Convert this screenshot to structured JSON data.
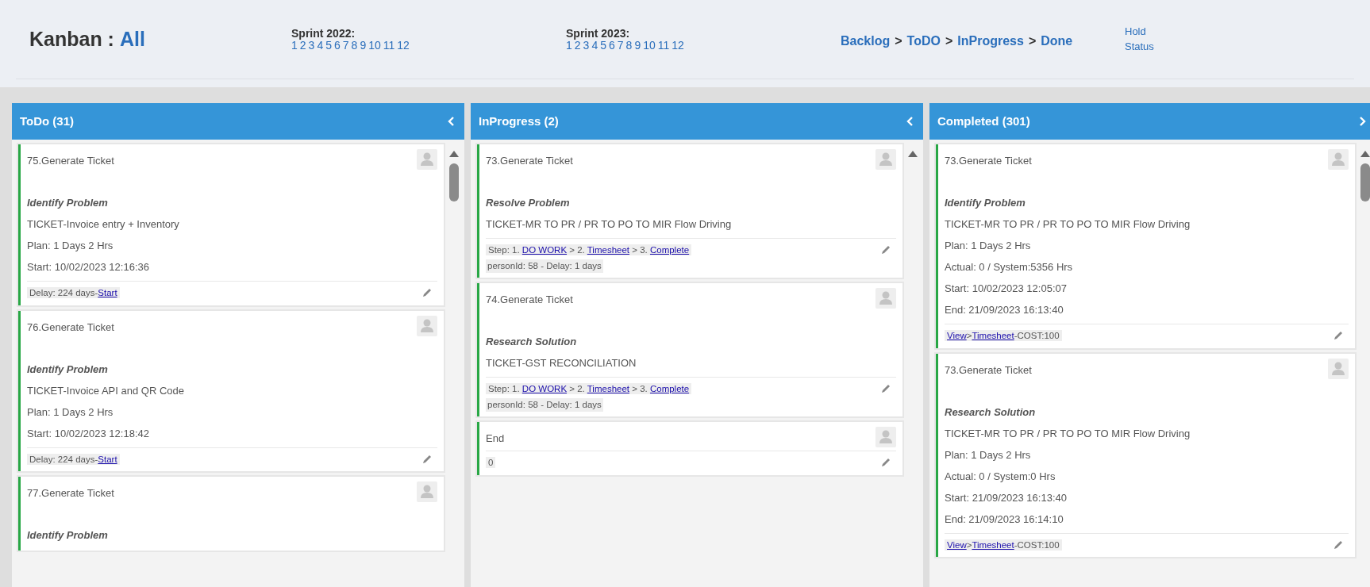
{
  "header": {
    "title": "Kanban :",
    "filter": "All",
    "sprints": [
      {
        "label": "Sprint 2022:",
        "numbers": [
          "1",
          "2",
          "3",
          "4",
          "5",
          "6",
          "7",
          "8",
          "9",
          "10",
          "11",
          "12"
        ]
      },
      {
        "label": "Sprint 2023:",
        "numbers": [
          "1",
          "2",
          "3",
          "4",
          "5",
          "6",
          "7",
          "8",
          "9",
          "10",
          "11",
          "12"
        ]
      }
    ],
    "workflow": [
      {
        "text": "Backlog",
        "kind": "link"
      },
      {
        "text": ">",
        "kind": "separator"
      },
      {
        "text": "ToDO",
        "kind": "link"
      },
      {
        "text": ">",
        "kind": "separator"
      },
      {
        "text": "InProgress",
        "kind": "link"
      },
      {
        "text": ">",
        "kind": "separator"
      },
      {
        "text": "Done",
        "kind": "link"
      }
    ],
    "extra_links": [
      "Hold",
      "Status"
    ]
  },
  "columns": [
    {
      "title": "ToDo (31)",
      "chevron_right": false,
      "scrollable": true,
      "cards": [
        {
          "title": "75.Generate Ticket",
          "stage": "Identify Problem",
          "lines": [
            "TICKET-Invoice entry + Inventory",
            "Plan: 1 Days 2 Hrs",
            "Start: 10/02/2023 12:16:36"
          ],
          "footer": [
            {
              "text": "Delay: 224 days-",
              "kind": "text"
            },
            {
              "text": "Start",
              "kind": "link"
            }
          ]
        },
        {
          "title": "76.Generate Ticket",
          "stage": "Identify Problem",
          "lines": [
            "TICKET-Invoice API and QR Code",
            "Plan: 1 Days 2 Hrs",
            "Start: 10/02/2023 12:18:42"
          ],
          "footer": [
            {
              "text": "Delay: 224 days-",
              "kind": "text"
            },
            {
              "text": "Start",
              "kind": "link"
            }
          ]
        },
        {
          "title": "77.Generate Ticket",
          "stage": "Identify Problem"
        }
      ]
    },
    {
      "title": "InProgress (2)",
      "chevron_right": false,
      "scrollable": false,
      "cards": [
        {
          "title": "73.Generate Ticket",
          "stage": "Resolve Problem",
          "lines": [
            "TICKET-MR TO PR / PR TO PO TO MIR Flow Driving"
          ],
          "footer": [
            {
              "text": "Step: 1. ",
              "kind": "text"
            },
            {
              "text": "DO WORK",
              "kind": "link"
            },
            {
              "text": " > 2. ",
              "kind": "text"
            },
            {
              "text": "Timesheet",
              "kind": "link"
            },
            {
              "text": " > 3. ",
              "kind": "text"
            },
            {
              "text": "Complete",
              "kind": "link"
            }
          ],
          "note": "personId: 58 - Delay: 1 days"
        },
        {
          "title": "74.Generate Ticket",
          "stage": "Research Solution",
          "lines": [
            "TICKET-GST RECONCILIATION"
          ],
          "footer": [
            {
              "text": "Step: 1. ",
              "kind": "text"
            },
            {
              "text": "DO WORK",
              "kind": "link"
            },
            {
              "text": " > 2. ",
              "kind": "text"
            },
            {
              "text": "Timesheet",
              "kind": "link"
            },
            {
              "text": " > 3. ",
              "kind": "text"
            },
            {
              "text": "Complete",
              "kind": "link"
            }
          ],
          "note": "personId: 58 - Delay: 1 days"
        },
        {
          "title": "End",
          "footer": [
            {
              "text": "0",
              "kind": "text"
            }
          ]
        }
      ]
    },
    {
      "title": "Completed (301)",
      "chevron_right": true,
      "scrollable": true,
      "cards": [
        {
          "title": "73.Generate Ticket",
          "stage": "Identify Problem",
          "lines": [
            "TICKET-MR TO PR / PR TO PO TO MIR Flow Driving",
            "Plan: 1 Days 2 Hrs",
            "Actual: 0 / System:5356 Hrs",
            "Start: 10/02/2023 12:05:07",
            "End: 21/09/2023 16:13:40"
          ],
          "footer": [
            {
              "text": "View",
              "kind": "link"
            },
            {
              "text": ">",
              "kind": "text"
            },
            {
              "text": "Timesheet",
              "kind": "link"
            },
            {
              "text": "-COST:100",
              "kind": "text"
            }
          ]
        },
        {
          "title": "73.Generate Ticket",
          "stage": "Research Solution",
          "lines": [
            "TICKET-MR TO PR / PR TO PO TO MIR Flow Driving",
            "Plan: 1 Days 2 Hrs",
            "Actual: 0 / System:0 Hrs",
            "Start: 21/09/2023 16:13:40",
            "End: 21/09/2023 16:14:10"
          ],
          "footer": [
            {
              "text": "View",
              "kind": "link"
            },
            {
              "text": ">",
              "kind": "text"
            },
            {
              "text": "Timesheet",
              "kind": "link"
            },
            {
              "text": "-COST:100",
              "kind": "text"
            }
          ]
        }
      ]
    }
  ]
}
